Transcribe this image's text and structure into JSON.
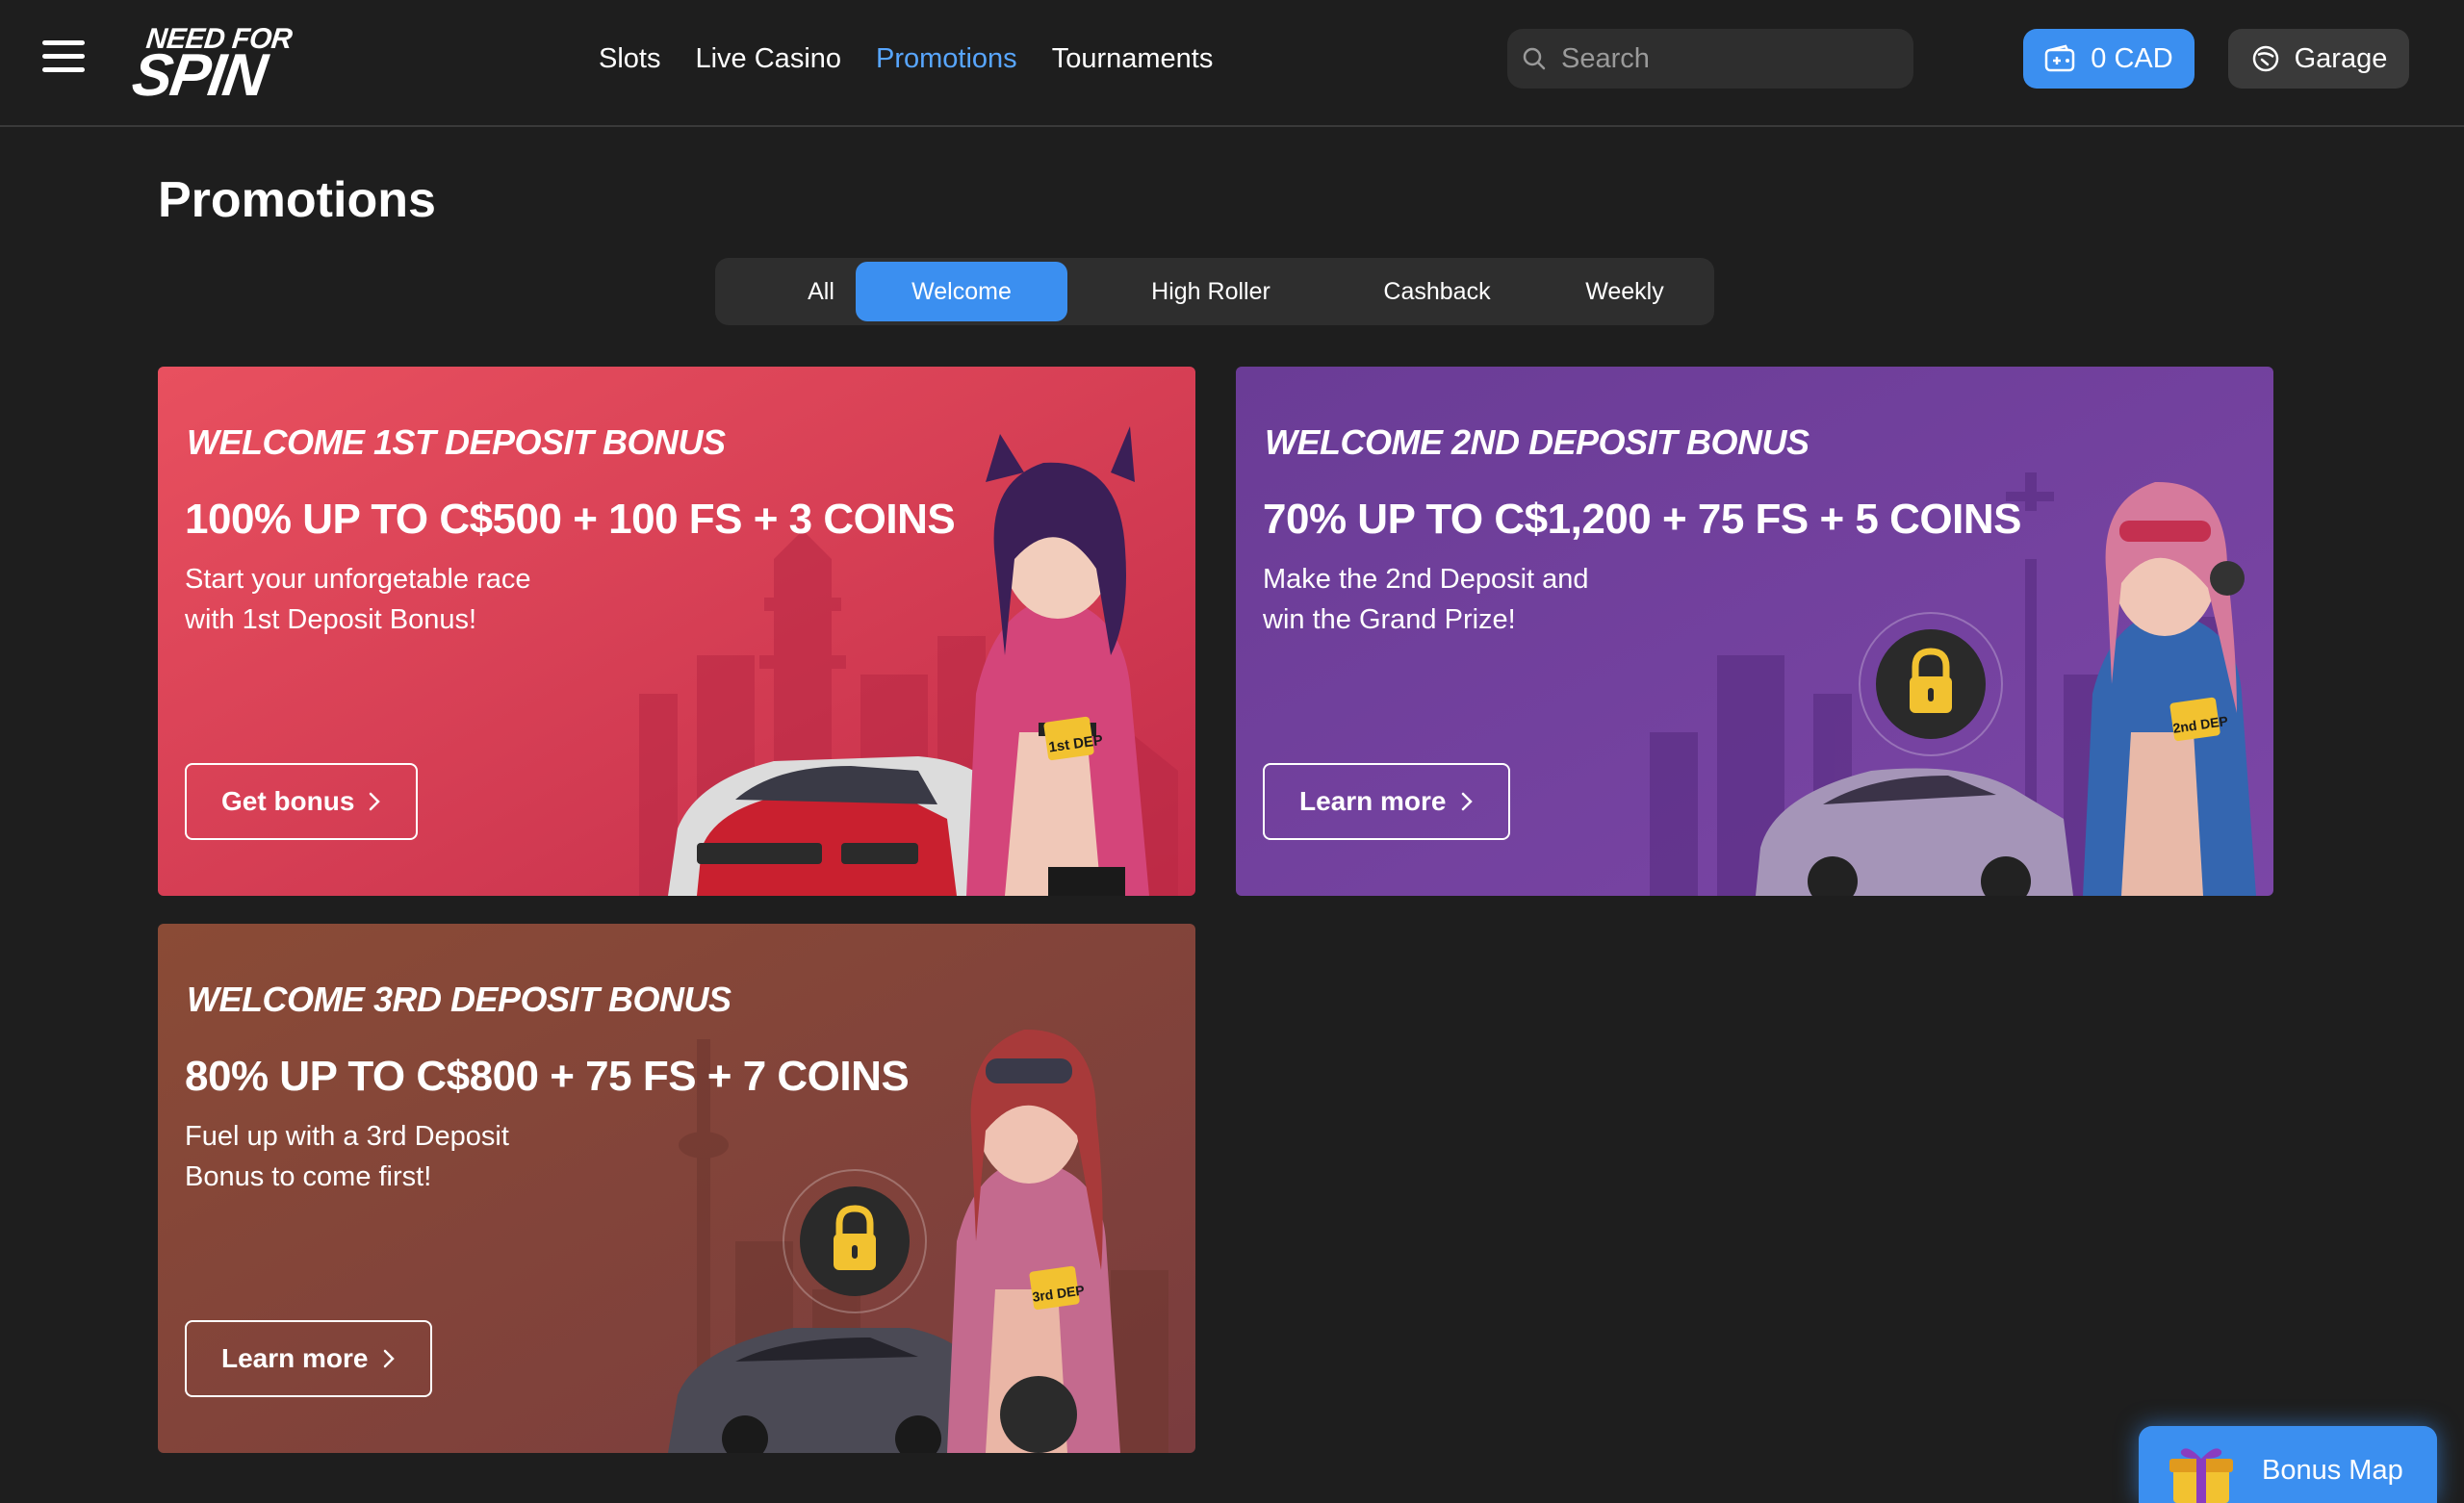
{
  "header": {
    "logo": {
      "line1": "NEED FOR",
      "line2": "SPIN"
    },
    "nav": [
      {
        "label": "Slots",
        "active": false
      },
      {
        "label": "Live Casino",
        "active": false
      },
      {
        "label": "Promotions",
        "active": true
      },
      {
        "label": "Tournaments",
        "active": false
      }
    ],
    "search": {
      "placeholder": "Search",
      "value": ""
    },
    "balance": {
      "label": "0 CAD",
      "icon": "wallet-icon"
    },
    "garage": {
      "label": "Garage",
      "icon": "steering-wheel-icon"
    }
  },
  "page": {
    "title": "Promotions"
  },
  "tabs": [
    {
      "label": "All",
      "active": false
    },
    {
      "label": "Welcome",
      "active": true
    },
    {
      "label": "High Roller",
      "active": false
    },
    {
      "label": "Cashback",
      "active": false
    },
    {
      "label": "Weekly",
      "active": false
    }
  ],
  "cards": [
    {
      "kicker": "WELCOME 1ST DEPOSIT BONUS",
      "headline": "100% UP TO C$500 + 100 FS + 3 COINS",
      "desc_line1": "Start your unforgetable race",
      "desc_line2": "with 1st Deposit Bonus!",
      "button": "Get bonus",
      "locked": false,
      "color": "#e34a5f",
      "badge": "1st DEP"
    },
    {
      "kicker": "WELCOME 2ND DEPOSIT BONUS",
      "headline": "70% UP TO C$1,200 + 75 FS + 5 COINS",
      "desc_line1": "Make the 2nd Deposit and",
      "desc_line2": "win the Grand Prize!",
      "button": "Learn more",
      "locked": true,
      "color": "#6b3a94",
      "badge": "2nd DEP"
    },
    {
      "kicker": "WELCOME 3RD DEPOSIT BONUS",
      "headline": "80% UP TO C$800 + 75 FS + 7 COINS",
      "desc_line1": "Fuel up with a 3rd Deposit",
      "desc_line2": "Bonus to come first!",
      "button": "Learn more",
      "locked": true,
      "color": "#8a4a37",
      "badge": "3rd DEP"
    }
  ],
  "bonus_map": {
    "label": "Bonus Map",
    "icon": "gift-icon"
  },
  "colors": {
    "accent": "#3b8ff0",
    "nav_active": "#58a6ff",
    "background": "#1e1e1e",
    "lock_yellow": "#f2c230"
  }
}
